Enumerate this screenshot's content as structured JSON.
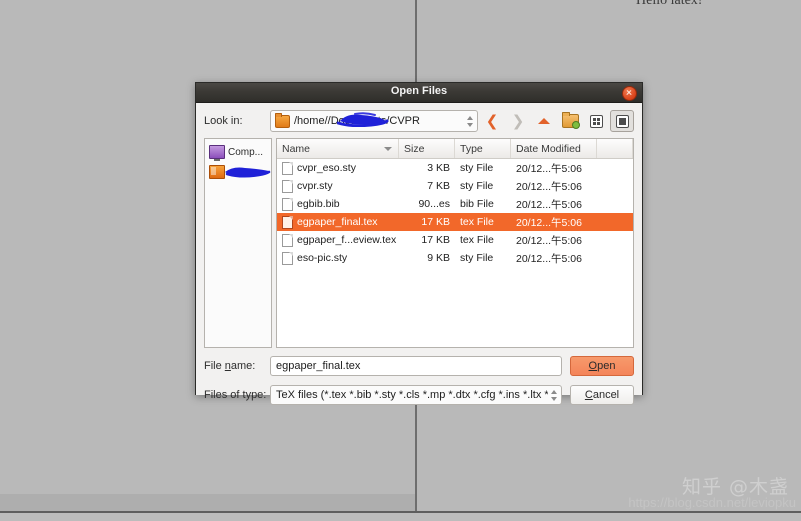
{
  "background": {
    "document_text": "Hello latex!",
    "watermark_zhihu": "知乎 @木盏",
    "watermark_url": "https://blog.csdn.net/leviopku"
  },
  "dialog": {
    "title": "Open Files",
    "close_icon": "close-icon",
    "lookin": {
      "label": "Look in:",
      "path_prefix": "/home/",
      "path_suffix": "/Documents/CVPR",
      "redacted": true
    },
    "toolbar": {
      "back": "❮",
      "forward": "❯",
      "parent": "up-caret",
      "new_folder": "new-folder-icon",
      "list_view": "list-view-icon",
      "detail_view": "detail-view-icon"
    },
    "sidebar": {
      "items": [
        {
          "label": "Comp...",
          "icon": "computer-icon",
          "redacted": false
        },
        {
          "label": "",
          "icon": "home-folder-icon",
          "redacted": true
        }
      ]
    },
    "filelist": {
      "columns": [
        "Name",
        "Size",
        "Type",
        "Date Modified"
      ],
      "sorted_by": "Name",
      "rows": [
        {
          "name": "cvpr_eso.sty",
          "size": "3 KB",
          "type": "sty File",
          "date": "20/12...午5:06",
          "selected": false
        },
        {
          "name": "cvpr.sty",
          "size": "7 KB",
          "type": "sty File",
          "date": "20/12...午5:06",
          "selected": false
        },
        {
          "name": "egbib.bib",
          "size": "90...es",
          "type": "bib File",
          "date": "20/12...午5:06",
          "selected": false
        },
        {
          "name": "egpaper_final.tex",
          "size": "17 KB",
          "type": "tex File",
          "date": "20/12...午5:06",
          "selected": true
        },
        {
          "name": "egpaper_f...eview.tex",
          "size": "17 KB",
          "type": "tex File",
          "date": "20/12...午5:06",
          "selected": false
        },
        {
          "name": "eso-pic.sty",
          "size": "9 KB",
          "type": "sty File",
          "date": "20/12...午5:06",
          "selected": false
        }
      ]
    },
    "filename": {
      "label_before": "File ",
      "label_key": "n",
      "label_after": "ame:",
      "value": "egpaper_final.tex",
      "placeholder": "File name"
    },
    "filetype": {
      "label": "Files of type:",
      "value": "TeX files (*.tex *.bib *.sty *.cls *.mp *.dtx *.cfg *.ins *.ltx *.tik"
    },
    "buttons": {
      "open_before": "",
      "open_key": "O",
      "open_after": "pen",
      "cancel_before": "",
      "cancel_key": "C",
      "cancel_after": "ancel"
    }
  },
  "colors": {
    "selection": "#f2682a",
    "accent": "#e2622a",
    "titlebar": "#3b3935",
    "open_button": "#f4845a",
    "desktop": "#b9b9b9",
    "redaction": "#1a1ad6"
  }
}
